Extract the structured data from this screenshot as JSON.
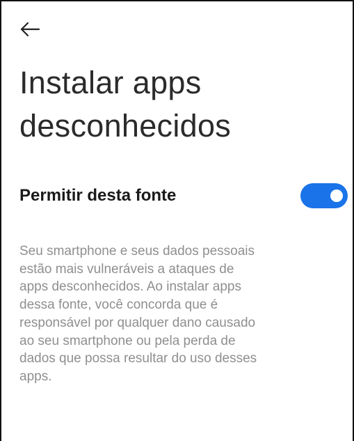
{
  "header": {
    "back_icon": "arrow-left-icon"
  },
  "page": {
    "title_lines": [
      "Instalar apps",
      "desconhecidos"
    ]
  },
  "setting": {
    "label": "Permitir desta fonte",
    "toggle_on": true,
    "toggle_color": "#1a73e8"
  },
  "description": {
    "lines": [
      "Seu smartphone e seus dados pessoais",
      "estão mais vulneráveis a ataques de",
      "apps desconhecidos. Ao instalar apps",
      "dessa fonte, você concorda que é",
      "responsável por qualquer dano causado",
      "ao seu smartphone ou pela perda de",
      "dados que possa resultar do uso desses",
      "apps."
    ]
  }
}
